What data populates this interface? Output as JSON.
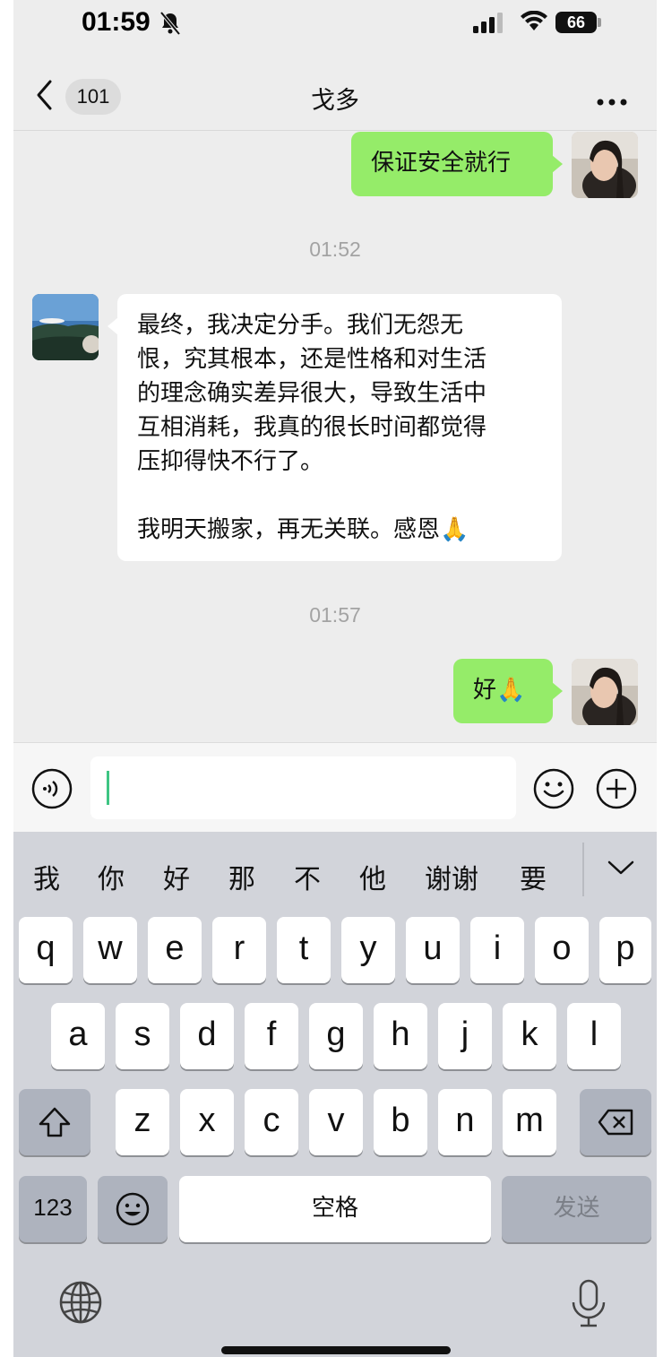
{
  "status_bar": {
    "time": "01:59",
    "battery": "66",
    "icons": [
      "bell-slash-icon",
      "cellular-signal-icon",
      "wifi-icon",
      "battery-icon"
    ]
  },
  "nav": {
    "back_icon": "chevron-left-icon",
    "unread_count": "101",
    "title": "戈多",
    "more_icon": "ellipsis-icon"
  },
  "messages": [
    {
      "from": "me",
      "text": "保证安全就行"
    },
    {
      "timestamp": "01:52"
    },
    {
      "from": "them",
      "text": "最终，我决定分手。我们无怨无\n恨，究其根本，还是性格和对生活\n的理念确实差异很大，导致生活中\n互相消耗，我真的很长时间都觉得\n压抑得快不行了。\n\n我明天搬家，再无关联。感恩🙏"
    },
    {
      "timestamp": "01:57"
    },
    {
      "from": "me",
      "text": "好🙏"
    }
  ],
  "input_bar": {
    "voice_icon": "voice-input-icon",
    "text_value": "",
    "emoji_icon": "smiley-icon",
    "plus_icon": "plus-circle-icon"
  },
  "keyboard": {
    "candidates": [
      "我",
      "你",
      "好",
      "那",
      "不",
      "他",
      "谢谢",
      "要"
    ],
    "collapse_icon": "chevron-down-icon",
    "row1": [
      "q",
      "w",
      "e",
      "r",
      "t",
      "y",
      "u",
      "i",
      "o",
      "p"
    ],
    "row2": [
      "a",
      "s",
      "d",
      "f",
      "g",
      "h",
      "j",
      "k",
      "l"
    ],
    "row3": [
      "z",
      "x",
      "c",
      "v",
      "b",
      "n",
      "m"
    ],
    "shift_icon": "shift-icon",
    "delete_icon": "backspace-icon",
    "numbers_label": "123",
    "emoji_key_icon": "emoji-icon",
    "space_label": "空格",
    "send_label": "发送",
    "globe_icon": "globe-icon",
    "mic_icon": "microphone-icon"
  },
  "colors": {
    "my_bubble": "#95ec69",
    "their_bubble": "#ffffff",
    "chat_background": "#ededed",
    "caret": "#3ec583"
  }
}
